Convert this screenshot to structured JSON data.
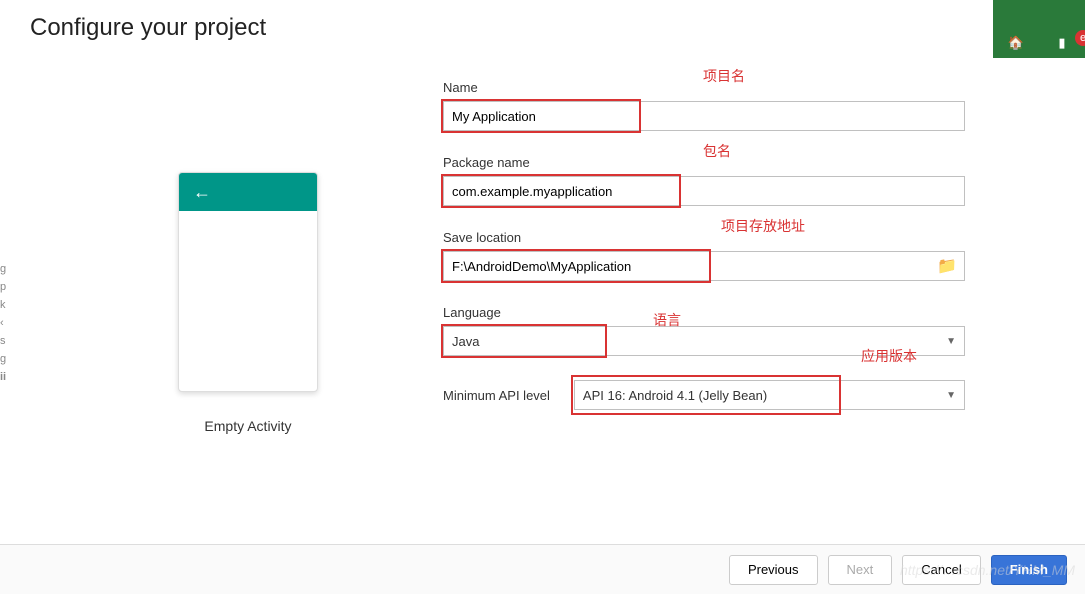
{
  "title": "Configure your project",
  "preview": {
    "label": "Empty Activity"
  },
  "fields": {
    "name": {
      "label": "Name",
      "value": "My Application"
    },
    "package": {
      "label": "Package name",
      "value": "com.example.myapplication"
    },
    "location": {
      "label": "Save location",
      "value": "F:\\AndroidDemo\\MyApplication"
    },
    "language": {
      "label": "Language",
      "value": "Java"
    },
    "api": {
      "label": "Minimum API level",
      "value": "API 16: Android 4.1 (Jelly Bean)"
    }
  },
  "annotations": {
    "name": "项目名",
    "package": "包名",
    "location": "项目存放地址",
    "language": "语言",
    "api": "应用版本"
  },
  "buttons": {
    "previous": "Previous",
    "next": "Next",
    "cancel": "Cancel",
    "finish": "Finish"
  }
}
